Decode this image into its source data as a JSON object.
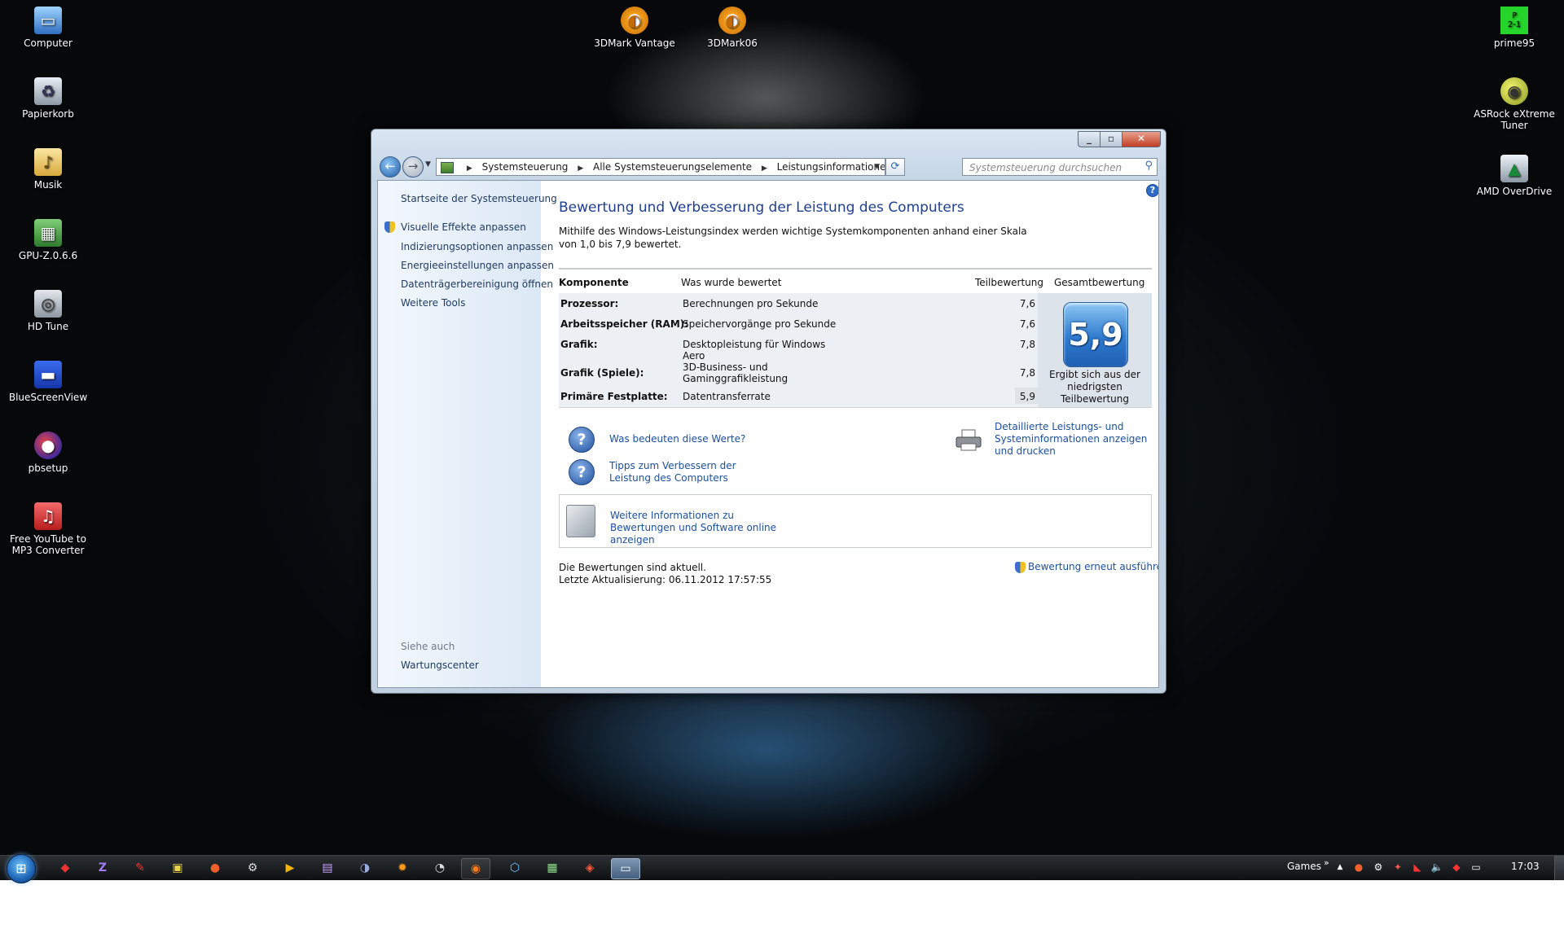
{
  "desktop": {
    "icons_left": [
      "Computer",
      "Papierkorb",
      "Musik",
      "GPU-Z.0.6.6",
      "HD Tune",
      "BlueScreenView",
      "pbsetup",
      "Free YouTube to MP3 Converter"
    ],
    "icons_top": [
      "3DMark Vantage",
      "3DMark06"
    ],
    "icons_right": [
      "prime95",
      "ASRock eXtreme Tuner",
      "AMD OverDrive"
    ],
    "prime95_badge": "P\n2-1"
  },
  "window": {
    "breadcrumb": [
      "Systemsteuerung",
      "Alle Systemsteuerungselemente",
      "Leistungsinformationen und -tools"
    ],
    "search_placeholder": "Systemsteuerung durchsuchen",
    "left_links": {
      "home": "Startseite der Systemsteuerung",
      "visual_effects": "Visuelle Effekte anpassen",
      "indexing": "Indizierungsoptionen anpassen",
      "power": "Energieeinstellungen anpassen",
      "disk_cleanup": "Datenträgerbereinigung öffnen",
      "more_tools": "Weitere Tools",
      "see_also": "Siehe auch",
      "action_center": "Wartungscenter"
    },
    "title": "Bewertung und Verbesserung der Leistung des Computers",
    "description": "Mithilfe des Windows-Leistungsindex werden wichtige Systemkomponenten anhand einer Skala von 1,0 bis 7,9 bewertet.",
    "table": {
      "headers": {
        "component": "Komponente",
        "rated": "Was wurde bewertet",
        "subscore": "Teilbewertung",
        "basescore": "Gesamtbewertung"
      },
      "rows": [
        {
          "component": "Prozessor:",
          "rated": "Berechnungen pro Sekunde",
          "score": "7,6"
        },
        {
          "component": "Arbeitsspeicher (RAM):",
          "rated": "Speichervorgänge pro Sekunde",
          "score": "7,6"
        },
        {
          "component": "Grafik:",
          "rated": "Desktopleistung für Windows Aero",
          "score": "7,8"
        },
        {
          "component": "Grafik (Spiele):",
          "rated": "3D-Business- und Gaminggrafikleistung",
          "score": "7,8"
        },
        {
          "component": "Primäre Festplatte:",
          "rated": "Datentransferrate",
          "score": "5,9"
        }
      ],
      "base_score": "5,9",
      "base_caption": "Ergibt sich aus der niedrigsten Teilbewertung"
    },
    "links": {
      "what_mean": "Was bedeuten diese Werte?",
      "tips": "Tipps zum Verbessern der Leistung des Computers",
      "details": "Detaillierte Leistungs- und Systeminformationen anzeigen und drucken",
      "online_info": "Weitere Informationen zu Bewertungen und Software online anzeigen",
      "rerun": "Bewertung erneut ausführen"
    },
    "status": {
      "current": "Die Bewertungen sind aktuell.",
      "last_update": "Letzte Aktualisierung: 06.11.2012 17:57:55"
    }
  },
  "taskbar": {
    "toolbar_label": "Games",
    "chevron": "»",
    "clock": "17:03"
  }
}
